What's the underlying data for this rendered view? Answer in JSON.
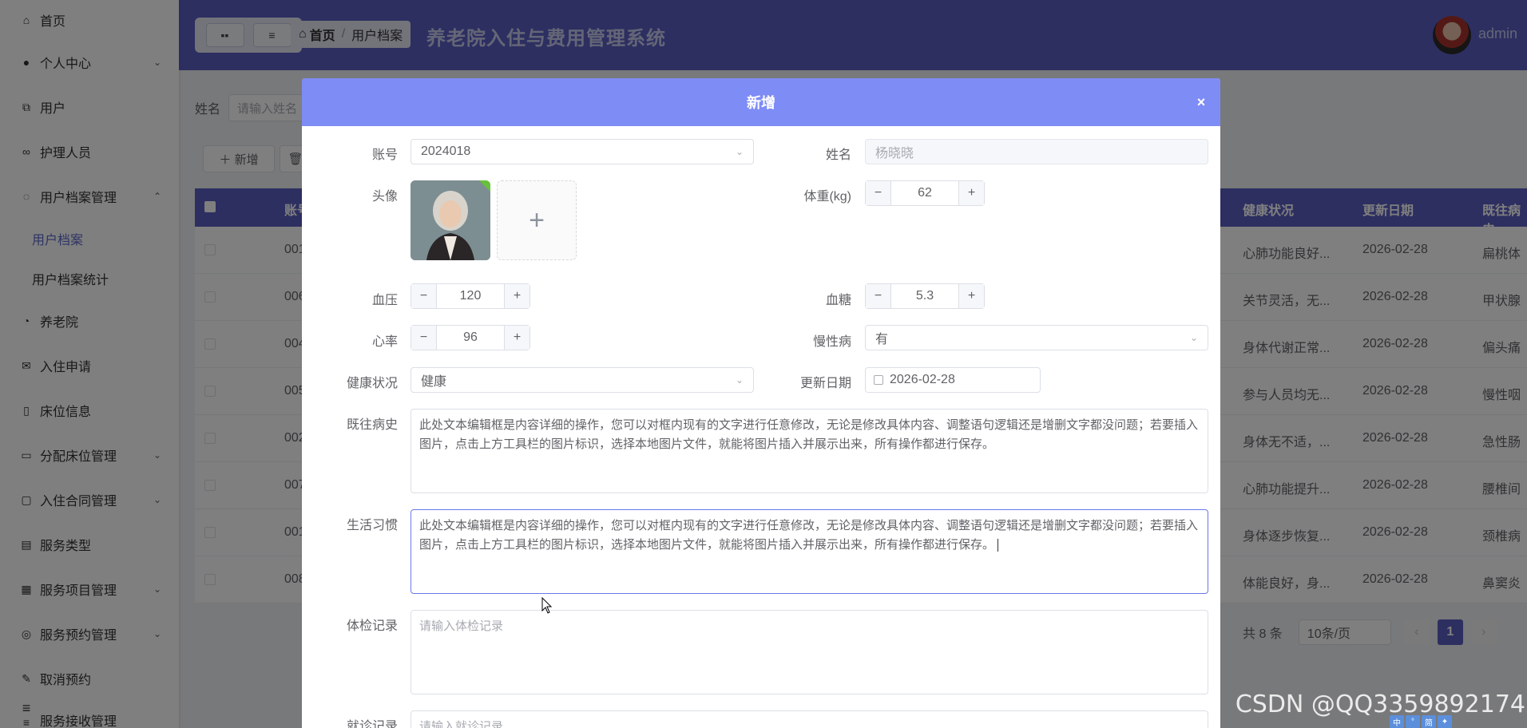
{
  "sidebar": {
    "items": [
      {
        "label": "首页",
        "icon": "home-icon"
      },
      {
        "label": "个人中心",
        "icon": "user-icon",
        "arrow": "⌄"
      },
      {
        "label": "用户",
        "icon": "external-link-icon"
      },
      {
        "label": "护理人员",
        "icon": "link-icon"
      },
      {
        "label": "用户档案管理",
        "icon": "chat-icon",
        "arrow": "⌃"
      },
      {
        "label": "养老院",
        "icon": "pie-icon"
      },
      {
        "label": "入住申请",
        "icon": "mail-icon"
      },
      {
        "label": "床位信息",
        "icon": "document-icon"
      },
      {
        "label": "分配床位管理",
        "icon": "wallet-icon",
        "arrow": "⌄"
      },
      {
        "label": "入住合同管理",
        "icon": "message-icon",
        "arrow": "⌄"
      },
      {
        "label": "服务类型",
        "icon": "building-icon"
      },
      {
        "label": "服务项目管理",
        "icon": "grid-icon",
        "arrow": "⌄"
      },
      {
        "label": "服务预约管理",
        "icon": "coins-icon",
        "arrow": "⌄"
      },
      {
        "label": "取消预约",
        "icon": "pen-icon"
      },
      {
        "label": "服务接收管理",
        "icon": "list-icon",
        "arrow": "⌄"
      }
    ],
    "subitems": [
      "用户档案",
      "用户档案统计"
    ]
  },
  "header": {
    "breadcrumb_home": "首页",
    "breadcrumb_sep": "/",
    "breadcrumb_current": "用户档案",
    "title": "养老院入住与费用管理系统",
    "user": "admin"
  },
  "background": {
    "search_label": "姓名",
    "search_placeholder": "请输入姓名",
    "add_button": "＋ 新增",
    "delete_button": "🗑",
    "columns": [
      "账号",
      "健康状况",
      "更新日期",
      "既往病史"
    ],
    "rows": [
      {
        "account": "001",
        "health": "心肺功能良好...",
        "date": "2026-02-28",
        "history": "扁桃体"
      },
      {
        "account": "006",
        "health": "关节灵活，无...",
        "date": "2026-02-28",
        "history": "甲状腺"
      },
      {
        "account": "004",
        "health": "身体代谢正常...",
        "date": "2026-02-28",
        "history": "偏头痛"
      },
      {
        "account": "005",
        "health": "参与人员均无...",
        "date": "2026-02-28",
        "history": "慢性咽"
      },
      {
        "account": "002",
        "health": "身体无不适，...",
        "date": "2026-02-28",
        "history": "急性肠"
      },
      {
        "account": "007",
        "health": "心肺功能提升...",
        "date": "2026-02-28",
        "history": "腰椎间"
      },
      {
        "account": "001",
        "health": "身体逐步恢复...",
        "date": "2026-02-28",
        "history": "颈椎病"
      },
      {
        "account": "008",
        "health": "体能良好，身...",
        "date": "2026-02-28",
        "history": "鼻窦炎"
      }
    ],
    "total": "共 8 条",
    "page_size": "10条/页",
    "prev": "‹",
    "current_page": "1",
    "next": "›"
  },
  "dialog": {
    "title": "新增",
    "close": "×",
    "account_label": "账号",
    "account_value": "2024018",
    "name_label": "姓名",
    "name_value": "杨晓晓",
    "avatar_label": "头像",
    "weight_label": "体重(kg)",
    "weight_value": "62",
    "bp_label": "血压",
    "bp_value": "120",
    "sugar_label": "血糖",
    "sugar_value": "5.3",
    "hr_label": "心率",
    "hr_value": "96",
    "chronic_label": "慢性病",
    "chronic_value": "有",
    "health_label": "健康状况",
    "health_value": "健康",
    "date_label": "更新日期",
    "date_value": "2026-02-28",
    "history_label": "既往病史",
    "history_value": "此处文本编辑框是内容详细的操作，您可以对框内现有的文字进行任意修改，无论是修改具体内容、调整语句逻辑还是增删文字都没问题；若要插入图片，点击上方工具栏的图片标识，选择本地图片文件，就能将图片插入并展示出来，所有操作都进行保存。",
    "habits_label": "生活习惯",
    "habits_value": "此处文本编辑框是内容详细的操作，您可以对框内现有的文字进行任意修改，无论是修改具体内容、调整语句逻辑还是增删文字都没问题；若要插入图片，点击上方工具栏的图片标识，选择本地图片文件，就能将图片插入并展示出来，所有操作都进行保存。",
    "exam_label": "体检记录",
    "exam_placeholder": "请输入体检记录",
    "visit_label": "就诊记录",
    "visit_placeholder": "请输入就诊记录"
  },
  "watermark": "CSDN @QQ3359892174",
  "colors": {
    "header": "#5b5ec2",
    "dialog_header": "#7e8cf5",
    "active": "#5b67ca"
  }
}
